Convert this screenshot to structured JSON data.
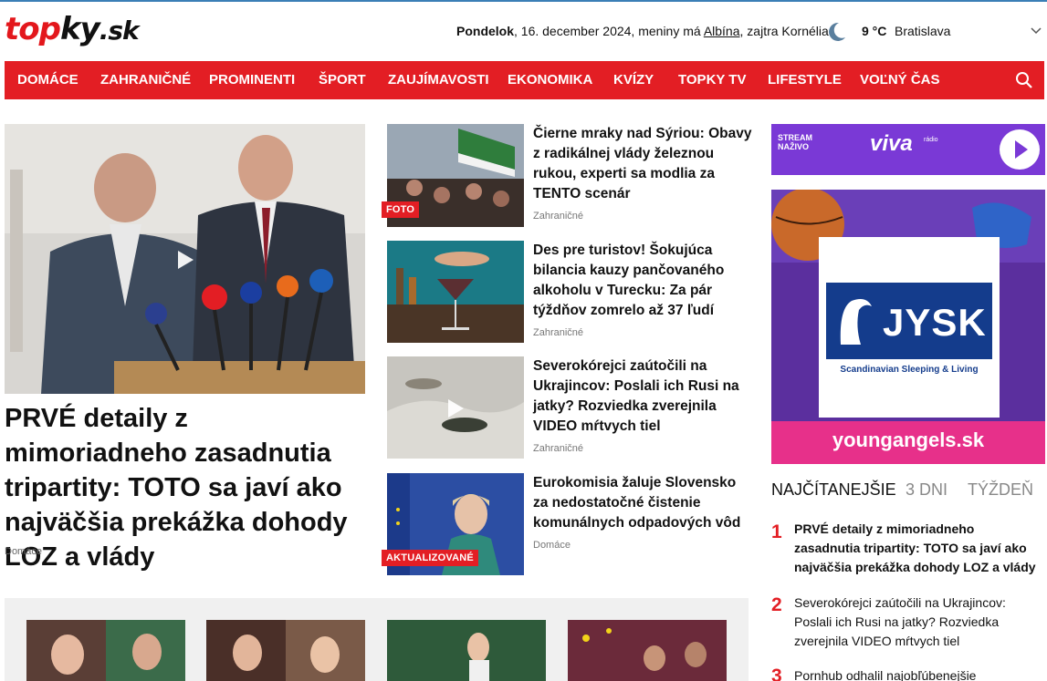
{
  "logo": {
    "part1": "top",
    "part2": "ky",
    "part3": ".sk"
  },
  "dateline": {
    "day": "Pondelok",
    "date": ", 16. december 2024, meniny má ",
    "nameday": "Albína",
    "tomorrow": ", zajtra Kornélia"
  },
  "weather": {
    "temp": "9 °C",
    "city": "Bratislava",
    "icon": "moon-icon"
  },
  "nav": {
    "items": [
      "DOMÁCE",
      "ZAHRANIČNÉ",
      "PROMINENTI",
      "ŠPORT",
      "ZAUJÍMAVOSTI",
      "EKONOMIKA",
      "KVÍZY",
      "TOPKY TV",
      "LIFESTYLE",
      "VOĽNÝ ČAS"
    ],
    "search_icon": "search-icon"
  },
  "lead": {
    "title": "PRVÉ detaily z mimoriadneho zasadnutia tripartity: TOTO sa javí ako najväčšia prekážka dohody LOZ a vlády",
    "category": "Domáce"
  },
  "articles": [
    {
      "title": "Čierne mraky nad Sýriou: Obavy z radikálnej vlády železnou rukou, experti sa modlia za TENTO scenár",
      "category": "Zahraničné",
      "badge": "FOTO"
    },
    {
      "title": "Des pre turistov! Šokujúca bilancia kauzy pančovaného alkoholu v Turecku: Za pár týždňov zomrelo až 37 ľudí",
      "category": "Zahraničné",
      "badge": ""
    },
    {
      "title": "Severokórejci zaútočili na Ukrajincov: Poslali ich Rusi na jatky? Rozviedka zverejnila VIDEO mŕtvych tiel",
      "category": "Zahraničné",
      "badge": ""
    },
    {
      "title": "Eurokomisia žaluje Slovensko za nedostatočné čistenie komunálnych odpadových vôd",
      "category": "Domáce",
      "badge": "AKTUALIZOVANÉ"
    }
  ],
  "stream": {
    "label_line1": "STREAM",
    "label_line2": "NAŽIVO",
    "brand": "viva",
    "brand_sub": "rádio"
  },
  "ad": {
    "brand": "JYSK",
    "tagline": "Scandinavian Sleeping & Living",
    "url": "youngangels.sk"
  },
  "most_read": {
    "tabs": [
      "NAJČÍTANEJŠIE",
      "3 DNI",
      "TÝŽDEŇ"
    ],
    "items": [
      {
        "num": "1",
        "title": "PRVÉ detaily z mimoriadneho zasadnutia tripartity: TOTO sa javí ako najväčšia prekážka dohody LOZ a vlády"
      },
      {
        "num": "2",
        "title": "Severokórejci zaútočili na Ukrajincov: Poslali ich Rusi na jatky? Rozviedka zverejnila VIDEO mŕtvych tiel"
      },
      {
        "num": "3",
        "title": "Pornhub odhalil najobľúbenejšie"
      }
    ]
  },
  "colors": {
    "brand_red": "#e31e24",
    "stream_purple": "#7a39d6",
    "ad_pink": "#e7308a",
    "jysk_blue": "#143c8c"
  }
}
